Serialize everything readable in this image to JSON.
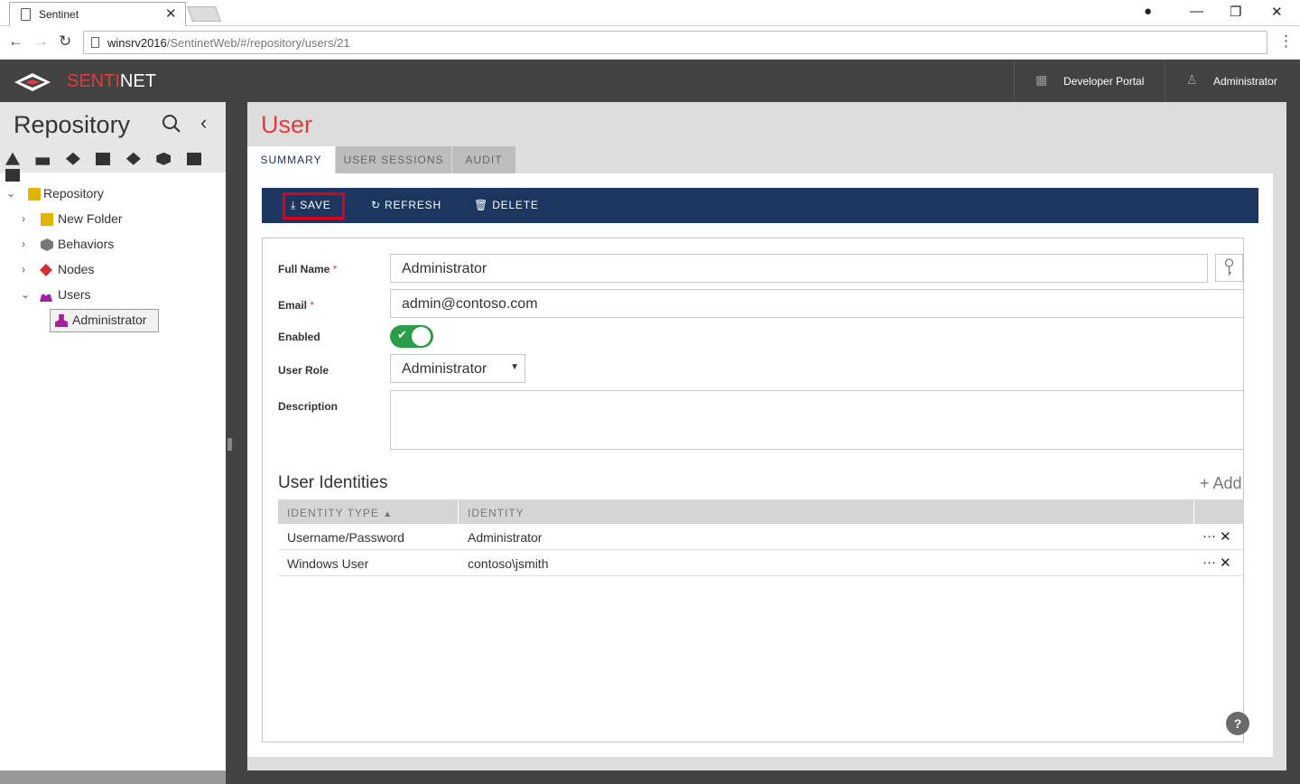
{
  "browser": {
    "tab_title": "Sentinet",
    "url_host": "winsrv2016",
    "url_path": "/SentinetWeb/#/repository/users/21"
  },
  "app": {
    "logo_prefix": "SENTI",
    "logo_suffix": "NET",
    "developer_portal": "Developer Portal",
    "user": "Administrator"
  },
  "sidebar": {
    "title": "Repository",
    "tree": [
      {
        "label": "Repository",
        "icon": "repository-icon",
        "color": "#e0b400"
      },
      {
        "label": "New Folder",
        "icon": "folder-icon",
        "color": "#e0b400"
      },
      {
        "label": "Behaviors",
        "icon": "behaviors-icon",
        "color": "#777777"
      },
      {
        "label": "Nodes",
        "icon": "nodes-icon",
        "color": "#d32f2f"
      },
      {
        "label": "Users",
        "icon": "users-icon",
        "color": "#a020a0"
      },
      {
        "label": "Administrator",
        "icon": "user-icon",
        "color": "#a020a0"
      }
    ]
  },
  "page": {
    "title": "User",
    "tabs": [
      {
        "label": "SUMMARY",
        "active": true
      },
      {
        "label": "USER SESSIONS",
        "active": false
      },
      {
        "label": "AUDIT",
        "active": false
      }
    ]
  },
  "toolbar": {
    "save": "SAVE",
    "refresh": "REFRESH",
    "delete": "DELETE"
  },
  "form": {
    "full_name_label": "Full Name",
    "full_name": "Administrator",
    "email_label": "Email",
    "email": "admin@contoso.com",
    "enabled_label": "Enabled",
    "enabled": true,
    "role_label": "User Role",
    "role": "Administrator",
    "description_label": "Description",
    "required_mark": "*"
  },
  "identities": {
    "title": "User Identities",
    "add": "+ Add",
    "columns": [
      "IDENTITY TYPE",
      "IDENTITY"
    ],
    "rows": [
      {
        "type": "Username/Password",
        "identity": "Administrator"
      },
      {
        "type": "Windows User",
        "identity": "contoso\\jsmith"
      }
    ]
  },
  "help": "?",
  "colors": {
    "accent": "#e5383b",
    "toolbar": "#1c3660",
    "toggle_on": "#2a9d49",
    "header": "#434343"
  }
}
